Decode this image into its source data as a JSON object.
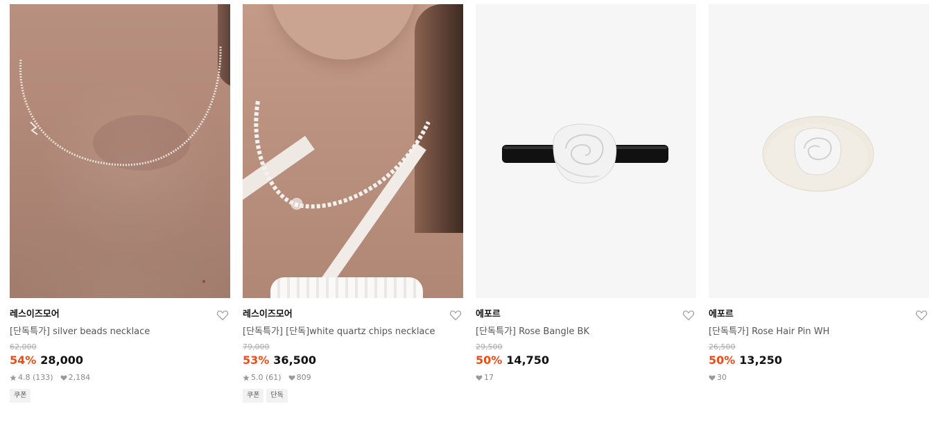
{
  "products": [
    {
      "brand": "레스이즈모어",
      "title": "[단독특가] silver beads necklace",
      "original_price": "62,000",
      "discount": "54%",
      "price": "28,000",
      "rating": "4.8",
      "reviews": "(133)",
      "likes": "2,184",
      "tags": [
        "쿠폰"
      ],
      "image_icon": "necklace-photo"
    },
    {
      "brand": "레스이즈모어",
      "title": "[단독특가] [단독]white quartz chips necklace",
      "original_price": "79,000",
      "discount": "53%",
      "price": "36,500",
      "rating": "5.0",
      "reviews": "(61)",
      "likes": "809",
      "tags": [
        "쿠폰",
        "단독"
      ],
      "image_icon": "necklace-photo"
    },
    {
      "brand": "에포르",
      "title": "[단독특가] Rose Bangle BK",
      "original_price": "29,500",
      "discount": "50%",
      "price": "14,750",
      "likes": "17",
      "tags": [],
      "image_icon": "rose-bangle-photo"
    },
    {
      "brand": "에포르",
      "title": "[단독특가] Rose Hair Pin WH",
      "original_price": "26,500",
      "discount": "50%",
      "price": "13,250",
      "likes": "30",
      "tags": [],
      "image_icon": "rose-hairpin-photo"
    }
  ],
  "colors": {
    "discount": "#f04b14",
    "price": "#111111",
    "muted": "#888888"
  }
}
